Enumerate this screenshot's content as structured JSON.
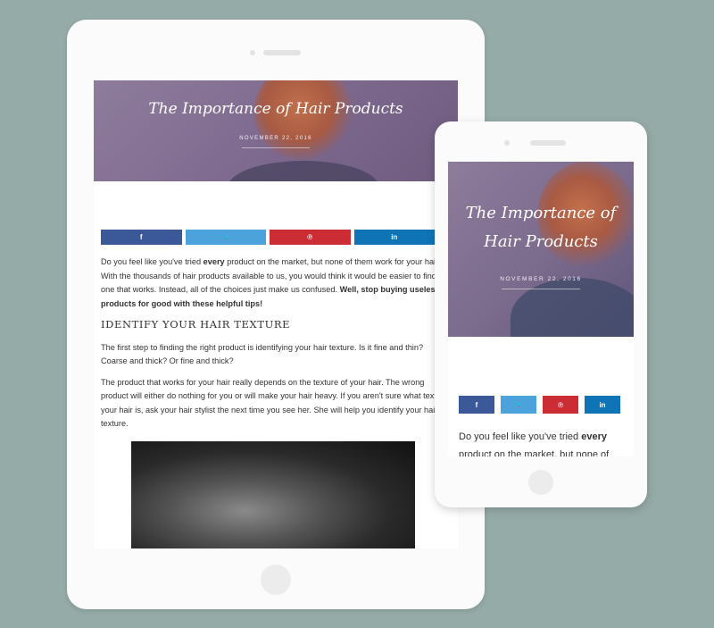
{
  "tablet": {
    "post_title": "The Importance of Hair Products",
    "post_date": "NOVEMBER 22, 2016",
    "share": {
      "facebook": "f",
      "twitter": "🐦",
      "pinterest": "℗",
      "linkedin": "in"
    },
    "intro_a": "Do you feel like you've tried ",
    "intro_b": "every",
    "intro_c": " product on the market, but none of them work for your hair? With the thousands of hair products available to us, you would think it would be easier to find one that works. Instead, all of the choices just make us confused. ",
    "intro_d": "Well, stop buying useless products for good with these helpful tips!",
    "heading": "IDENTIFY YOUR HAIR TEXTURE",
    "para2": "The first step to finding the right product is identifying your hair texture. Is it fine and thin? Coarse and thick? Or fine and thick?",
    "para3": "The product that works for your hair really depends on the texture of your hair. The wrong product will either do nothing for you or will make your hair heavy. If you aren't sure what texture your hair is, ask your hair stylist the next time you see her. She will help you identify your hair texture."
  },
  "phone": {
    "post_title_line1": "The Importance of",
    "post_title_line2": "Hair Products",
    "post_date": "NOVEMBER 22, 2016",
    "share": {
      "facebook": "f",
      "twitter": "🐦",
      "pinterest": "℗",
      "linkedin": "in"
    },
    "intro_a": "Do you feel like you've tried ",
    "intro_b": "every",
    "intro_c": " product on the market, but none of"
  },
  "colors": {
    "background": "#95aba7",
    "facebook": "#3b5998",
    "twitter": "#4ca3dc",
    "pinterest": "#cc2d35",
    "linkedin": "#0e74b6"
  }
}
